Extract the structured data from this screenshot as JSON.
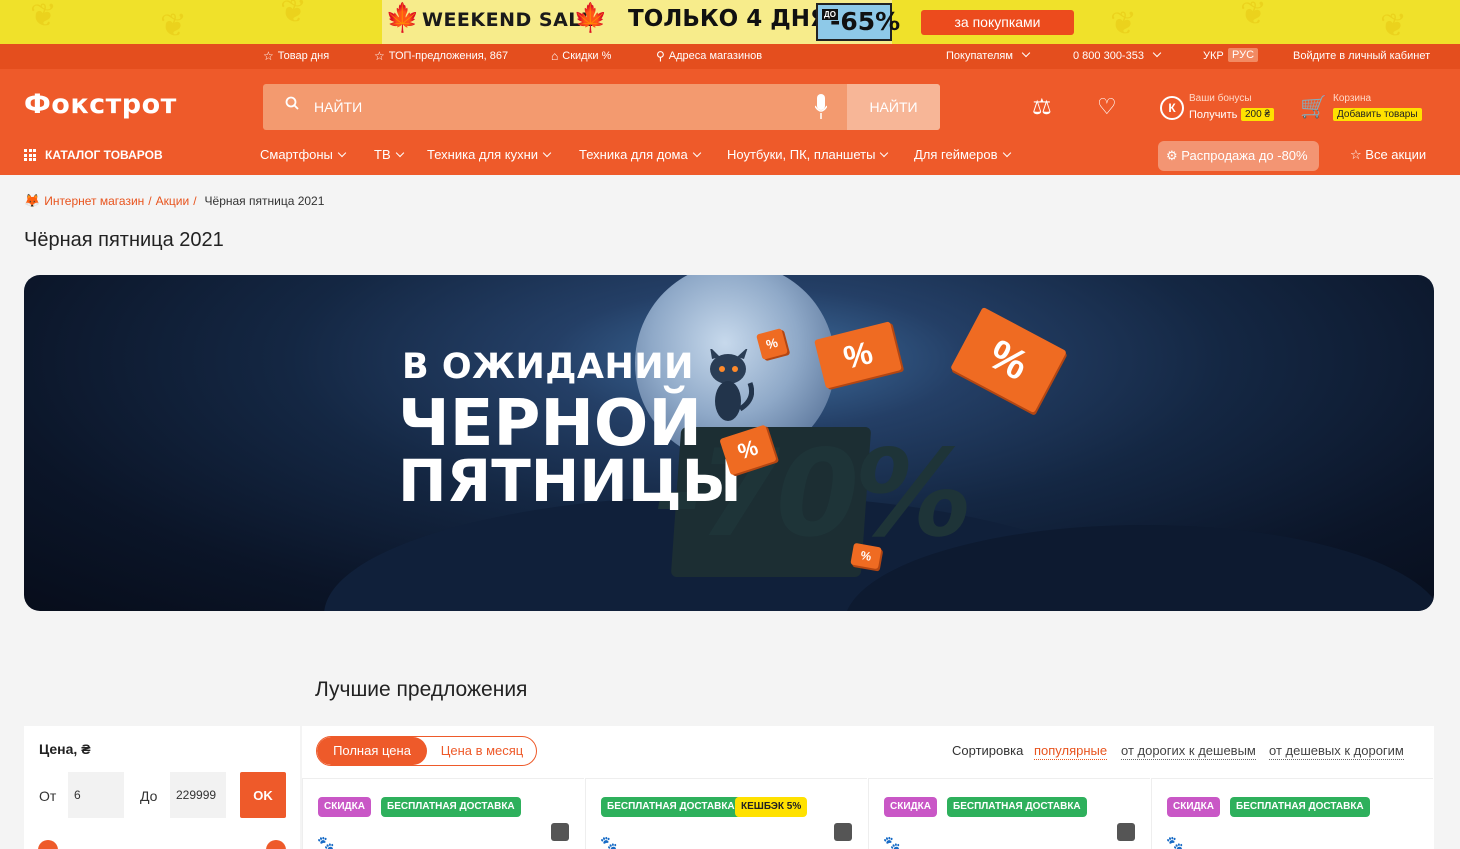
{
  "promo": {
    "left_title": "WEEKEND SALE",
    "middle_title": "ТОЛЬКО 4 ДНЯ",
    "upto": "ДО",
    "percent": "-65%",
    "button": "за покупками"
  },
  "topbar": {
    "left": [
      {
        "icon": "star-icon",
        "label": "Товар дня"
      },
      {
        "icon": "star-icon",
        "label": "ТОП-предложения, 867"
      },
      {
        "icon": "tag-icon",
        "label": "Скидки %"
      },
      {
        "icon": "location-pin-icon",
        "label": "Адреса магазинов"
      }
    ],
    "buyers": "Покупателям",
    "phone": "0 800 300-353",
    "lang_ua": "УКР",
    "lang_ru": "РУС",
    "login": "Войдите в личный кабинет"
  },
  "header": {
    "logo": "Фокстрот",
    "search_placeholder": "НАЙТИ",
    "search_button": "НАЙТИ",
    "bonus_title": "Ваши бонусы",
    "bonus_get": "Получить",
    "bonus_amount": "200 ₴",
    "cart_title": "Корзина",
    "cart_add": "Добавить товары"
  },
  "nav": {
    "catalog": "КАТАЛОГ ТОВАРОВ",
    "items": [
      "Смартфоны",
      "ТВ",
      "Техника для кухни",
      "Техника для дома",
      "Ноутбуки, ПК, планшеты",
      "Для геймеров"
    ],
    "sale": "Распродажа до -80%",
    "all_promos": "Все акции"
  },
  "breadcrumb": {
    "items": [
      "Интернет магазин",
      "Акции"
    ],
    "current": "Чёрная пятница 2021"
  },
  "page": {
    "title": "Чёрная пятница 2021"
  },
  "banner": {
    "line1": "В ОЖИДАНИИ",
    "line2": "ЧЕРНОЙ",
    "line3": "ПЯТНИЦЫ",
    "discount": "-70%"
  },
  "offers": {
    "title": "Лучшие предложения",
    "filter": {
      "title": "Цена, ₴",
      "from_label": "От",
      "from_value": "6",
      "to_label": "До",
      "to_value": "229999",
      "ok": "OK"
    },
    "toggle": {
      "full": "Полная цена",
      "monthly": "Цена в месяц"
    },
    "sort": {
      "label": "Сортировка",
      "options": [
        "популярные",
        "от дорогих к дешевым",
        "от дешевых к дорогим"
      ]
    },
    "cards": [
      {
        "badges": [
          "СКИДКА",
          "БЕСПЛАТНАЯ ДОСТАВКА"
        ]
      },
      {
        "badges": [
          "БЕСПЛАТНАЯ ДОСТАВКА",
          "КЕШБЭК 5%"
        ]
      },
      {
        "badges": [
          "СКИДКА",
          "БЕСПЛАТНАЯ ДОСТАВКА"
        ]
      },
      {
        "badges": [
          "СКИДКА",
          "БЕСПЛАТНАЯ ДОСТАВКА"
        ]
      }
    ]
  },
  "colors": {
    "brand": "#ee5a2a",
    "promo_yellow": "#f0e12a",
    "badge_purple": "#c957c6",
    "badge_green": "#2eb05c",
    "badge_yellow": "#ffe100"
  }
}
